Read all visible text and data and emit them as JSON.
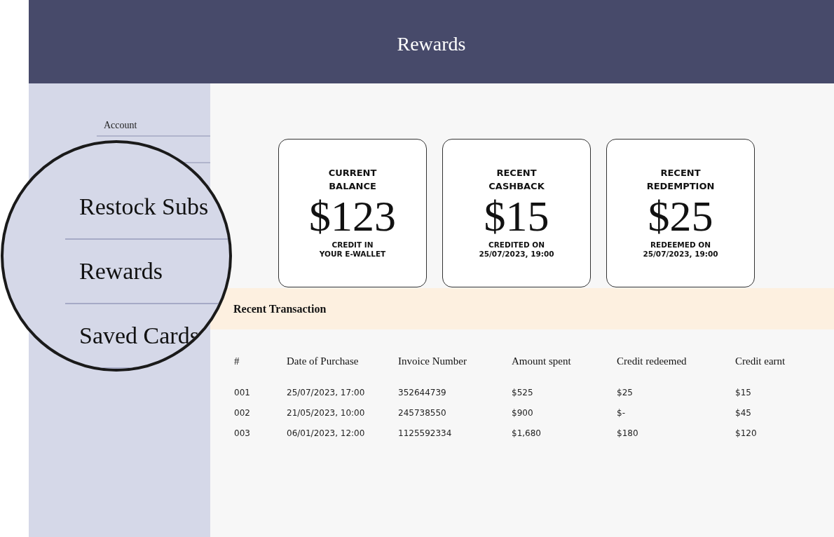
{
  "header": {
    "title": "Rewards"
  },
  "sidebar": {
    "items": [
      {
        "label": "Account"
      }
    ]
  },
  "magnifier": {
    "items": [
      {
        "label": "Restock Subs"
      },
      {
        "label": "Rewards"
      },
      {
        "label": "Saved Cards"
      }
    ]
  },
  "cards": [
    {
      "title": "CURRENT\nBALANCE",
      "amount": "$123",
      "caption": "CREDIT IN\nYOUR E-WALLET"
    },
    {
      "title": "RECENT\nCASHBACK",
      "amount": "$15",
      "caption": "CREDITED ON\n25/07/2023, 19:00"
    },
    {
      "title": "RECENT\nREDEMPTION",
      "amount": "$25",
      "caption": "REDEEMED ON\n25/07/2023, 19:00"
    }
  ],
  "transactions": {
    "title": "Recent Transaction",
    "columns": [
      "#",
      "Date of Purchase",
      "Invoice Number",
      "Amount spent",
      "Credit redeemed",
      "Credit earnt"
    ],
    "rows": [
      [
        "001",
        "25/07/2023, 17:00",
        "352644739",
        "$525",
        "$25",
        "$15"
      ],
      [
        "002",
        "21/05/2023, 10:00",
        "245738550",
        "$900",
        "$-",
        "$45"
      ],
      [
        "003",
        "06/01/2023, 12:00",
        "1125592334",
        "$1,680",
        "$180",
        "$120"
      ]
    ]
  }
}
